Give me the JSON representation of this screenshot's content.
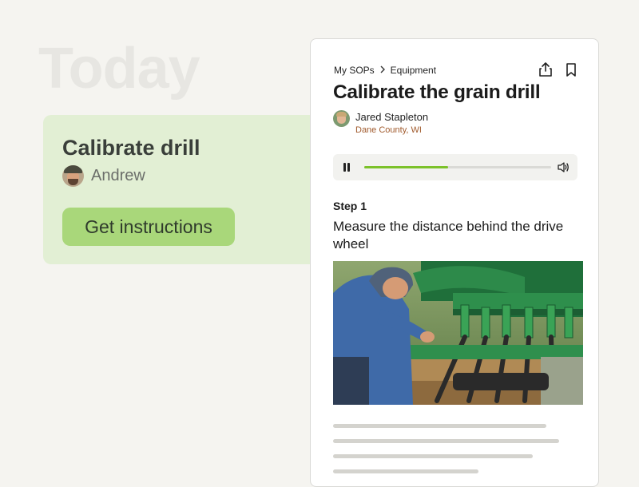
{
  "background_heading": "Today",
  "task_card": {
    "title": "Calibrate drill",
    "assignee": "Andrew",
    "cta_label": "Get instructions"
  },
  "sop": {
    "breadcrumb": [
      "My SOPs",
      "Equipment"
    ],
    "title": "Calibrate the grain drill",
    "author": {
      "name": "Jared Stapleton",
      "location": "Dane County, WI"
    },
    "audio": {
      "progress": 0.45,
      "state": "playing"
    },
    "step": {
      "label": "Step 1",
      "text": "Measure the distance behind the drive wheel"
    },
    "icons": [
      "share-icon",
      "bookmark-icon",
      "pause-icon",
      "volume-icon",
      "chevron-right-icon"
    ]
  },
  "colors": {
    "accent_green": "#7cc22a",
    "card_green": "#e2efd4",
    "button_green": "#a9d77a",
    "location_brown": "#a05a2c"
  }
}
